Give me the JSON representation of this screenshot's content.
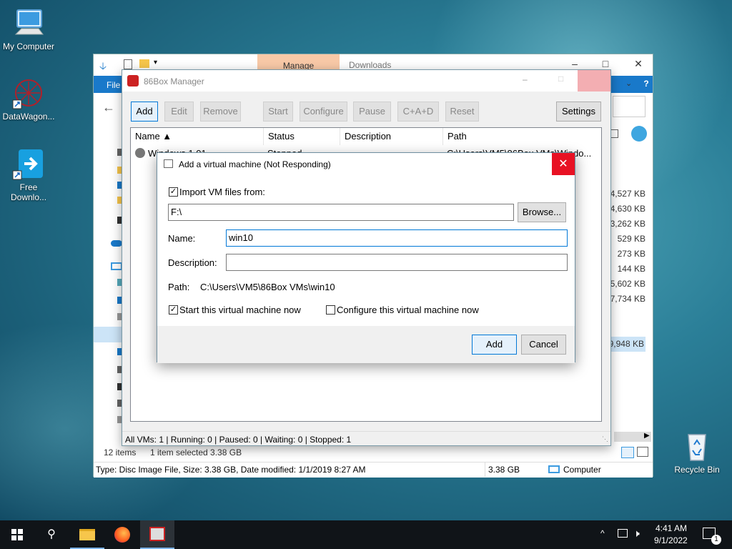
{
  "desktop": {
    "icons": [
      {
        "label": "My Computer"
      },
      {
        "label": "DataWagon..."
      },
      {
        "label": "Free Downlo..."
      },
      {
        "label": "Recycle Bin"
      }
    ]
  },
  "explorer": {
    "manage_tab": "Manage",
    "title": "Downloads",
    "ribbon_file": "File",
    "sizes": [
      "4,527 KB",
      "4,630 KB",
      "3,262 KB",
      "529 KB",
      "273 KB",
      "144 KB",
      "5,602 KB",
      "7,734 KB",
      "",
      "",
      "9,948 KB"
    ],
    "items_count": "12 items",
    "selected": "1 item selected  3.38 GB",
    "details_text": "Type: Disc Image File, Size: 3.38 GB, Date modified: 1/1/2019 8:27 AM",
    "details_size": "3.38 GB",
    "details_location": "Computer"
  },
  "manager": {
    "title": "86Box Manager",
    "toolbar": {
      "add": "Add",
      "edit": "Edit",
      "remove": "Remove",
      "start": "Start",
      "configure": "Configure",
      "pause": "Pause",
      "cad": "C+A+D",
      "reset": "Reset",
      "settings": "Settings"
    },
    "columns": {
      "name": "Name ▲",
      "status": "Status",
      "description": "Description",
      "path": "Path"
    },
    "rows": [
      {
        "name": "Windows 1.01",
        "status": "Stopped",
        "description": "",
        "path": "C:\\Users\\VM5\\86Box VMs\\Windo..."
      }
    ],
    "status_bar": "All VMs: 1 | Running: 0 | Paused: 0 | Waiting: 0 | Stopped: 1"
  },
  "dialog": {
    "title": "Add a virtual machine (Not Responding)",
    "import_label": "Import VM files from:",
    "import_checked": true,
    "import_path": "F:\\",
    "browse": "Browse...",
    "name_label": "Name:",
    "name_value": "win10",
    "description_label": "Description:",
    "description_value": "",
    "path_label": "Path:",
    "path_value": "C:\\Users\\VM5\\86Box VMs\\win10",
    "start_now_label": "Start this virtual machine now",
    "start_now_checked": true,
    "configure_now_label": "Configure this virtual machine now",
    "configure_now_checked": false,
    "add": "Add",
    "cancel": "Cancel"
  },
  "taskbar": {
    "time": "4:41 AM",
    "date": "9/1/2022",
    "notifications": "1"
  },
  "colors": {
    "accent": "#0078d7",
    "close_red": "#e81123",
    "ribbon_blue": "#1979ca",
    "manage_orange": "#f8c9a7"
  }
}
